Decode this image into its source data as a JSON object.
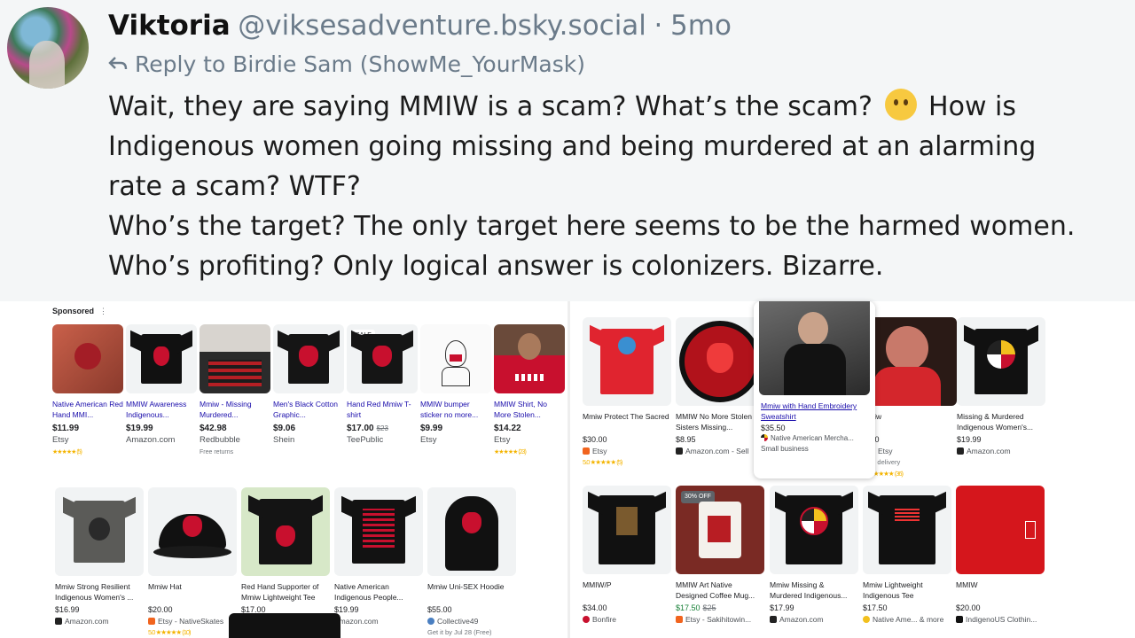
{
  "post": {
    "author": "Viktoria",
    "handle": "@viksesadventure.bsky.social",
    "separator": "·",
    "age": "5mo",
    "reply_to": "Reply to Birdie Sam (ShowMe_YourMask)",
    "lines": [
      "Wait, they are saying MMIW is a scam? What’s the scam?",
      "How is",
      "Indigenous women going missing and being murdered at an alarming",
      "rate a scam? WTF?",
      "Who’s the target? The only target here seems to be the harmed women.",
      "Who’s profiting? Only logical answer is colonizers. Bizarre."
    ],
    "emoji": "melting-face-emoji"
  },
  "left_panel": {
    "sponsored_label": "Sponsored",
    "more_label": "⋮",
    "sponsored_items": [
      {
        "title": "Native American Red Hand MMI...",
        "price": "$11.99",
        "store": "Etsy",
        "rating": "★★★★★ (5)"
      },
      {
        "title": "MMIW Awareness Indigenous...",
        "price": "$19.99",
        "store": "Amazon.com",
        "rating": ""
      },
      {
        "title": "Mmiw - Missing Murdered...",
        "price": "$42.98",
        "store": "Redbubble",
        "rating": "Free returns"
      },
      {
        "title": "Men's Black Cotton Graphic...",
        "price": "$9.06",
        "store": "Shein",
        "rating": ""
      },
      {
        "title": "Hand Red Mmiw T-shirt",
        "price": "$17.00",
        "old_price": "$23",
        "store": "TeePublic",
        "badge": "SALE",
        "rating": ""
      },
      {
        "title": "MMIW bumper sticker no more...",
        "price": "$9.99",
        "store": "Etsy",
        "rating": ""
      },
      {
        "title": "MMIW Shirt, No More Stolen...",
        "price": "$14.22",
        "store": "Etsy",
        "rating": "★★★★★ (23)"
      }
    ],
    "items": [
      {
        "title": "Mmiw Strong Resilient Indigenous Women's ...",
        "price": "$16.99",
        "store": "Amazon.com",
        "rating": ""
      },
      {
        "title": "Mmiw Hat",
        "price": "$20.00",
        "store": "Etsy - NativeSkates",
        "rating": "5.0 ★★★★★ (10)"
      },
      {
        "title": "Red Hand Supporter of Mmiw Lightweight Tee",
        "price": "$17.00",
        "store": "",
        "rating": ""
      },
      {
        "title": "Native American Indigenous People...",
        "price": "$19.99",
        "store": "Amazon.com",
        "rating": ""
      },
      {
        "title": "Mmiw Uni-SEX Hoodie",
        "price": "$55.00",
        "store": "Collective49",
        "rating": "Get it by Jul 28 (Free)"
      }
    ]
  },
  "right_panel": {
    "row1": [
      {
        "title": "Mmiw Protect The Sacred",
        "price": "$30.00",
        "store": "Etsy",
        "rating": "5.0 ★★★★★ (5)"
      },
      {
        "title": "MMIW No More Stolen Sisters Missing...",
        "price": "$8.95",
        "store": "Amazon.com - Sell",
        "rating": ""
      },
      {
        "title": "miw",
        "price": ".00",
        "store": "Etsy",
        "rating": "ee delivery"
      },
      {
        "title": "Missing & Murdered Indigenous Women's...",
        "price": "$19.99",
        "store": "Amazon.com",
        "rating": ""
      }
    ],
    "row1_extra_rating": "★★★★★ (36)",
    "popup": {
      "title": "Mmiw with Hand Embroidery Sweatshirt",
      "price": "$35.50",
      "store": "Native American Mercha...",
      "sub": "Small business"
    },
    "row2": [
      {
        "title": "MMIW/P",
        "price": "$34.00",
        "store": "Bonfire",
        "rating": ""
      },
      {
        "title": "MMIW Art Native Designed Coffee Mug...",
        "price": "$17.50",
        "old_price": "$25",
        "store": "Etsy - Sakihitowin...",
        "badge": "30% OFF",
        "rating": ""
      },
      {
        "title": "Mmiw Missing & Murdered Indigenous...",
        "price": "$17.99",
        "store": "Amazon.com",
        "rating": ""
      },
      {
        "title": "Mmiw Lightweight Indigenous Tee",
        "price": "$17.50",
        "store": "Native Ame... & more",
        "rating": ""
      },
      {
        "title": "MMIW",
        "price": "$20.00",
        "store": "IndigenoUS Clothin...",
        "rating": ""
      }
    ]
  },
  "colors": {
    "link": "#1a0dab",
    "star": "#f4b400",
    "red": "#c8102e",
    "sale_green": "#188038"
  }
}
